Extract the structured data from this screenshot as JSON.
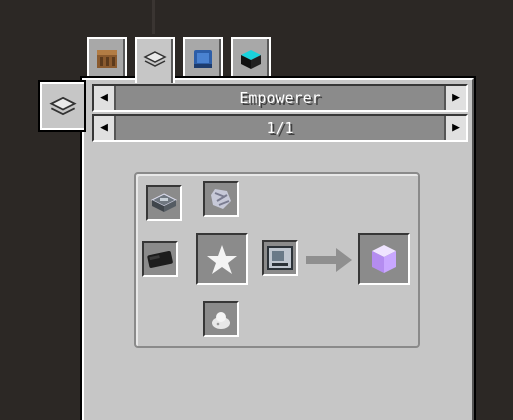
{
  "tabs": [
    {
      "name": "crafting-table",
      "icon": "crafting-table-icon",
      "active": false
    },
    {
      "name": "empowerer",
      "icon": "empowerer-icon",
      "active": true
    },
    {
      "name": "manual",
      "icon": "blue-book-icon",
      "active": false
    },
    {
      "name": "crystal-block",
      "icon": "black-crystal-block-icon",
      "active": false
    }
  ],
  "header": {
    "category": "Empowerer",
    "page": "1/1",
    "prev_symbol": "◀",
    "next_symbol": "▶"
  },
  "recipe": {
    "inputs": [
      "empowerer-base-icon",
      "clay-ball-icon",
      "coal-block-icon",
      "nether-star-icon",
      "cloud-dust-icon"
    ],
    "machine": "display-stand-icon",
    "output": "purple-crystal-block-icon"
  },
  "colors": {
    "panel": "#c6c6c6",
    "slot": "#8b8b8b",
    "arrow": "#8f8f8f",
    "output": "#c9a7ff"
  }
}
